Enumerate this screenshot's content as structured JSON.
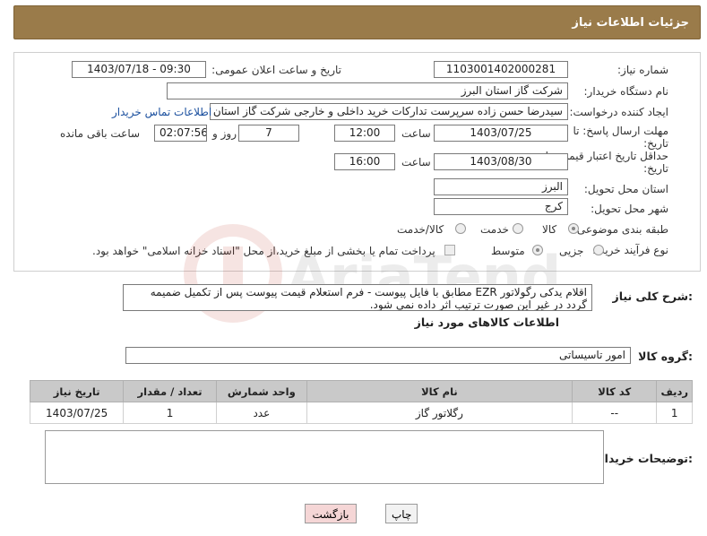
{
  "header": {
    "title": "جزئیات اطلاعات نیاز"
  },
  "form": {
    "need_number_label": "شماره نیاز:",
    "need_number": "1103001402000281",
    "announce_label": "تاریخ و ساعت اعلان عمومی:",
    "announce_value": "1403/07/18 - 09:30",
    "buyer_org_label": "نام دستگاه خریدار:",
    "buyer_org": "شرکت گاز استان البرز",
    "creator_label": "ایجاد کننده درخواست:",
    "creator": "سیدرضا حسن زاده سرپرست تدارکات خرید داخلی و خارجی شرکت گاز استان البرز",
    "contact_link": "اطلاعات تماس خریدار",
    "reply_deadline_label": "مهلت ارسال پاسخ: تا",
    "reply_deadline_label2": "تاریخ:",
    "reply_date": "1403/07/25",
    "time_label": "ساعت",
    "reply_time": "12:00",
    "days_value": "7",
    "days_label": "روز و",
    "remaining_time": "02:07:56",
    "remaining_label": "ساعت باقی مانده",
    "validity_label": "حداقل تاریخ اعتبار قیمت: تا",
    "validity_label2": "تاریخ:",
    "validity_date": "1403/08/30",
    "validity_time_label": "ساعت",
    "validity_time": "16:00",
    "province_label": "استان محل تحویل:",
    "province": "البرز",
    "city_label": "شهر محل تحویل:",
    "city": "کرج",
    "category_label": "طبقه بندی موضوعی:",
    "category_options": [
      "کالا",
      "خدمت",
      "کالا/خدمت"
    ],
    "process_label": "نوع فرآیند خرید :",
    "process_options": [
      "جزیی",
      "متوسط"
    ],
    "payment_note": "پرداخت تمام یا بخشی از مبلغ خرید،از محل \"اسناد خزانه اسلامی\" خواهد بود."
  },
  "description": {
    "label": "شرح کلی نیاز:",
    "text": "اقلام یدکی رگولاتور EZR مطابق با فایل پیوست - فرم استعلام قیمت پیوست پس از تکمیل ضمیمه گردد در غیر این صورت ترتیب اثر داده نمی شود."
  },
  "goods_section": {
    "title": "اطلاعات کالاهای مورد نیاز",
    "group_label": "گروه کالا:",
    "group_value": "امور تاسیساتی"
  },
  "table": {
    "headers": [
      "ردیف",
      "کد کالا",
      "نام کالا",
      "واحد شمارش",
      "تعداد / مقدار",
      "تاریخ نیاز"
    ],
    "rows": [
      [
        "1",
        "--",
        "رگلاتور گاز",
        "عدد",
        "1",
        "1403/07/25"
      ]
    ]
  },
  "notes": {
    "label": "توضیحات خریدار:"
  },
  "buttons": {
    "print": "چاپ",
    "back": "بازگشت"
  },
  "colors": {
    "header_bg": "#9a7b4a",
    "table_header_bg": "#c9c9c9",
    "back_button_bg": "#f5d6d6"
  }
}
